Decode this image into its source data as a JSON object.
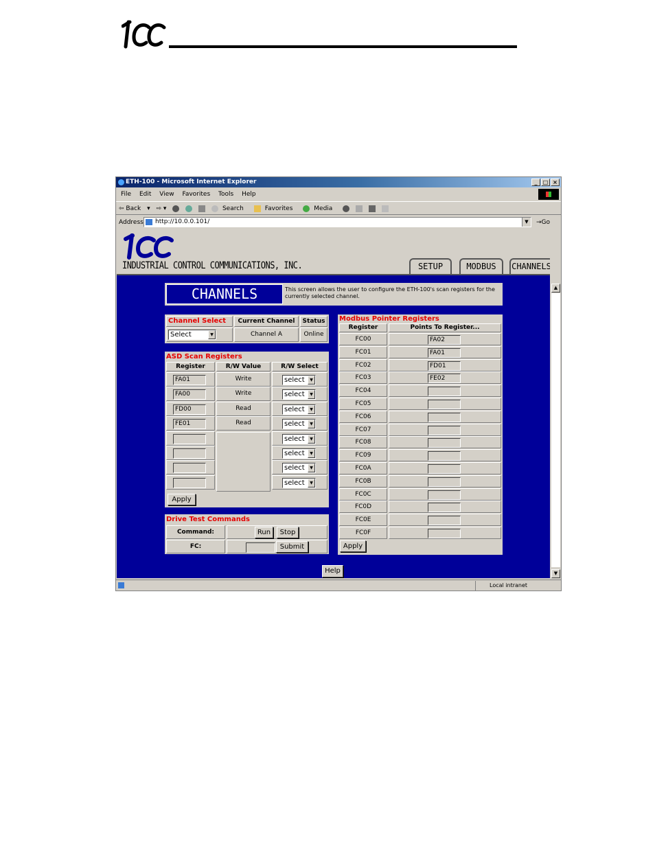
{
  "browser": {
    "title": "ETH-100 - Microsoft Internet Explorer",
    "menu": [
      "File",
      "Edit",
      "View",
      "Favorites",
      "Tools",
      "Help"
    ],
    "toolbar": {
      "back": "Back",
      "search": "Search",
      "favorites": "Favorites",
      "media": "Media"
    },
    "address_label": "Address",
    "address_url": "http://10.0.0.101/",
    "go": "Go",
    "status_zone": "Local intranet"
  },
  "site": {
    "company": "INDUSTRIAL CONTROL COMMUNICATIONS, INC.",
    "tabs": [
      "SETUP",
      "MODBUS",
      "CHANNELS"
    ]
  },
  "channels": {
    "heading": "CHANNELS",
    "description": "This screen allows the user to configure the ETH-100's scan registers for the currently selected channel."
  },
  "channel_select": {
    "title": "Channel Select",
    "current_header": "Current Channel",
    "status_header": "Status",
    "select_value": "Select",
    "current_value": "Channel A",
    "status_value": "Online"
  },
  "asd": {
    "title": "ASD Scan Registers",
    "headers": [
      "Register",
      "R/W Value",
      "R/W Select"
    ],
    "rows": [
      {
        "register": "FA01",
        "value": "Write",
        "select": "select"
      },
      {
        "register": "FA00",
        "value": "Write",
        "select": "select"
      },
      {
        "register": "FD00",
        "value": "Read",
        "select": "select"
      },
      {
        "register": "FE01",
        "value": "Read",
        "select": "select"
      },
      {
        "register": "",
        "value": "",
        "select": "select"
      },
      {
        "register": "",
        "value": "",
        "select": "select"
      },
      {
        "register": "",
        "value": "",
        "select": "select"
      },
      {
        "register": "",
        "value": "",
        "select": "select"
      }
    ],
    "apply": "Apply"
  },
  "drive_test": {
    "title": "Drive Test Commands",
    "command_label": "Command:",
    "run": "Run",
    "stop": "Stop",
    "fc_label": "FC:",
    "fc_value": "",
    "submit": "Submit"
  },
  "modbus": {
    "title": "Modbus Pointer Registers",
    "headers": [
      "Register",
      "Points To Register..."
    ],
    "rows": [
      {
        "register": "FC00",
        "points": "FA02"
      },
      {
        "register": "FC01",
        "points": "FA01"
      },
      {
        "register": "FC02",
        "points": "FD01"
      },
      {
        "register": "FC03",
        "points": "FE02"
      },
      {
        "register": "FC04",
        "points": ""
      },
      {
        "register": "FC05",
        "points": ""
      },
      {
        "register": "FC06",
        "points": ""
      },
      {
        "register": "FC07",
        "points": ""
      },
      {
        "register": "FC08",
        "points": ""
      },
      {
        "register": "FC09",
        "points": ""
      },
      {
        "register": "FC0A",
        "points": ""
      },
      {
        "register": "FC0B",
        "points": ""
      },
      {
        "register": "FC0C",
        "points": ""
      },
      {
        "register": "FC0D",
        "points": ""
      },
      {
        "register": "FC0E",
        "points": ""
      },
      {
        "register": "FC0F",
        "points": ""
      }
    ],
    "apply": "Apply"
  },
  "help": "Help"
}
